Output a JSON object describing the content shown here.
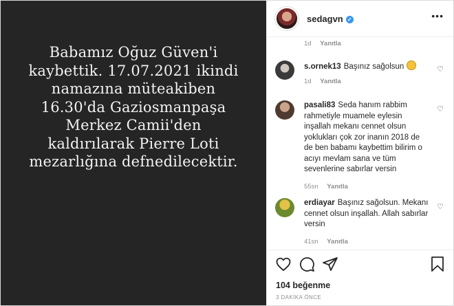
{
  "post": {
    "text_lines": [
      "Babamız Oğuz Güven'i",
      "kaybettik. 17.07.2021 ikindi",
      "namazına müteakiben",
      "16.30'da  Gaziosmanpaşa",
      "Merkez Camii'den",
      "kaldırılarak Pierre Loti",
      "mezarlığına defnedilecektir."
    ]
  },
  "header": {
    "username": "sedagvn",
    "verified": true,
    "more_label": "•••"
  },
  "caption_meta": {
    "age": "1d",
    "reply": "Yanıtla"
  },
  "comments": [
    {
      "username": "s.ornek13",
      "text": "Başınız sağolsun",
      "emoji": "sad-face-emoji",
      "age": "1d",
      "reply": "Yanıtla"
    },
    {
      "username": "pasali83",
      "text": "Seda hanım rabbim rahmetiyle muamele eylesin inşallah mekanı cennet olsun yoklukları çok zor inanın 2018 de de ben babamı kaybettim bilirim o acıyı mevlam sana ve tüm sevenlerine sabırlar versin",
      "age": "55sn",
      "reply": "Yanıtla"
    },
    {
      "username": "erdiayar",
      "text": "Başınız sağolsun. Mekanı cennet olsun inşallah. Allah sabırlar versin",
      "age": "41sn",
      "reply": "Yanıtla"
    }
  ],
  "footer": {
    "likes": "104 beğenme",
    "timestamp": "3 DAKİKA ÖNCE"
  },
  "colors": {
    "post_bg": "#252525",
    "verified": "#3897f0",
    "muted": "#8e8e8e"
  }
}
